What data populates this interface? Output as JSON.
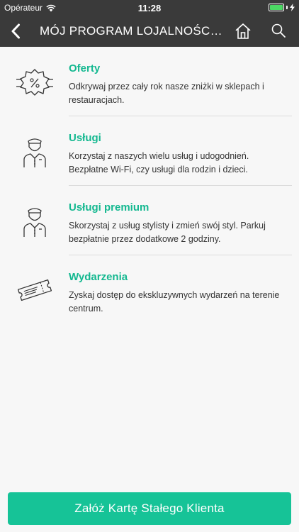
{
  "status_bar": {
    "carrier": "Opérateur",
    "time": "11:28",
    "battery_level": 1.0
  },
  "navbar": {
    "title": "MÓJ PROGRAM LOJALNOŚCIO...",
    "icons": [
      "back-chevron-icon",
      "home-icon",
      "search-icon"
    ]
  },
  "items": [
    {
      "title": "Oferty",
      "description": "Odkrywaj przez cały rok nasze zniżki w sklepach i restauracjach.",
      "icon": "discount-badge-icon"
    },
    {
      "title": "Usługi",
      "description": "Korzystaj z naszych wielu usług i udogodnień. Bezpłatne Wi-Fi, czy usługi dla rodzin i dzieci.",
      "icon": "concierge-icon"
    },
    {
      "title": "Usługi premium",
      "description": "Skorzystaj z usług stylisty i zmień swój styl. Parkuj bezpłatnie przez dodatkowe 2 godziny.",
      "icon": "concierge-icon"
    },
    {
      "title": "Wydarzenia",
      "description": "Zyskaj dostęp do ekskluzywnych wydarzeń na terenie centrum.",
      "icon": "ticket-icon"
    }
  ],
  "cta": {
    "label": "Załóż Kartę Stałego Klienta"
  },
  "colors": {
    "accent": "#14b890",
    "button": "#16c397",
    "bar": "#3a3a3a",
    "background": "#f7f7f7"
  }
}
